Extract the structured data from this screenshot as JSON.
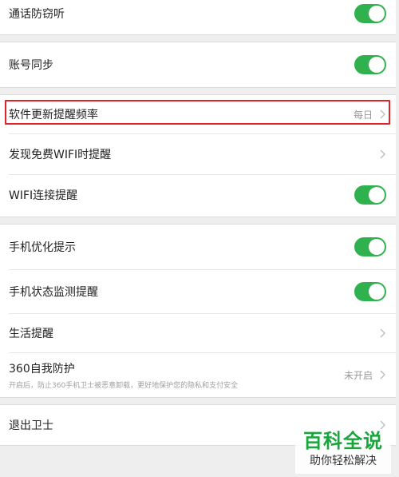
{
  "groups": [
    {
      "rows": [
        {
          "label": "通话防窃听",
          "toggle": true
        }
      ]
    },
    {
      "rows": [
        {
          "label": "账号同步",
          "toggle": true
        }
      ]
    },
    {
      "rows": [
        {
          "label": "软件更新提醒频率",
          "value": "每日"
        },
        {
          "label": "发现免费WIFI时提醒"
        },
        {
          "label": "WIFI连接提醒",
          "toggle": true
        }
      ]
    },
    {
      "rows": [
        {
          "label": "手机优化提示",
          "toggle": true
        },
        {
          "label": "手机状态监测提醒",
          "toggle": true
        },
        {
          "label": "生活提醒"
        },
        {
          "label": "360自我防护",
          "sublabel": "开启后，防止360手机卫士被恶意卸载，更好地保护您的隐私和支付安全",
          "value": "未开启"
        }
      ]
    },
    {
      "rows": [
        {
          "label": "退出卫士"
        }
      ]
    }
  ],
  "watermark": {
    "title": "百科全说",
    "subtitle": "助你轻松解决"
  },
  "colors": {
    "toggle_on": "#2fb14e",
    "highlight": "#e3232a",
    "watermark_green": "#1aa53c"
  }
}
